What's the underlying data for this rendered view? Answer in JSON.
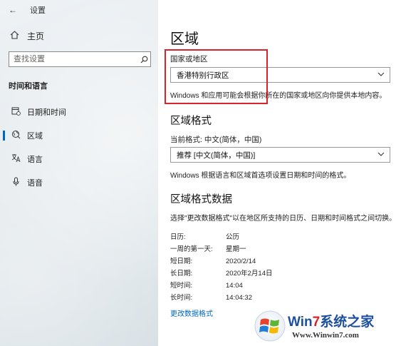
{
  "window": {
    "back_glyph": "←",
    "title": "设置"
  },
  "sidebar": {
    "home_label": "主页",
    "search_placeholder": "查找设置",
    "section_title": "时间和语言",
    "items": [
      {
        "label": "日期和时间",
        "icon": "calendar-clock-icon",
        "active": false
      },
      {
        "label": "区域",
        "icon": "globe-region-icon",
        "active": true
      },
      {
        "label": "语言",
        "icon": "language-icon",
        "active": false
      },
      {
        "label": "语音",
        "icon": "microphone-icon",
        "active": false
      }
    ]
  },
  "main": {
    "title": "区域",
    "country": {
      "label": "国家或地区",
      "value": "香港特别行政区",
      "description": "Windows 和应用可能会根据你所在的国家或地区向你提供本地内容。"
    },
    "format": {
      "heading": "区域格式",
      "current_label": "当前格式: 中文(简体，中国)",
      "value": "推荐 [中文(简体，中国)]",
      "description": "Windows 根据语言和区域首选项设置日期和时间的格式。"
    },
    "format_data": {
      "heading": "区域格式数据",
      "description": "选择\"更改数据格式\"以在地区所支持的日历、日期和时间格式之间切换。",
      "rows": [
        {
          "key": "日历:",
          "value": "公历"
        },
        {
          "key": "一周的第一天:",
          "value": "星期一"
        },
        {
          "key": "短日期:",
          "value": "2020/2/14"
        },
        {
          "key": "长日期:",
          "value": "2020年2月14日"
        },
        {
          "key": "短时间:",
          "value": "14:04"
        },
        {
          "key": "长时间:",
          "value": "14:04:32"
        }
      ],
      "change_link": "更改数据格式"
    }
  },
  "watermark": {
    "brand_prefix": "Win",
    "brand_seven": "7",
    "brand_suffix": "系统之家",
    "url": "Www.Winwin7.com"
  },
  "colors": {
    "accent": "#0067c0",
    "highlight": "#d8232a"
  }
}
